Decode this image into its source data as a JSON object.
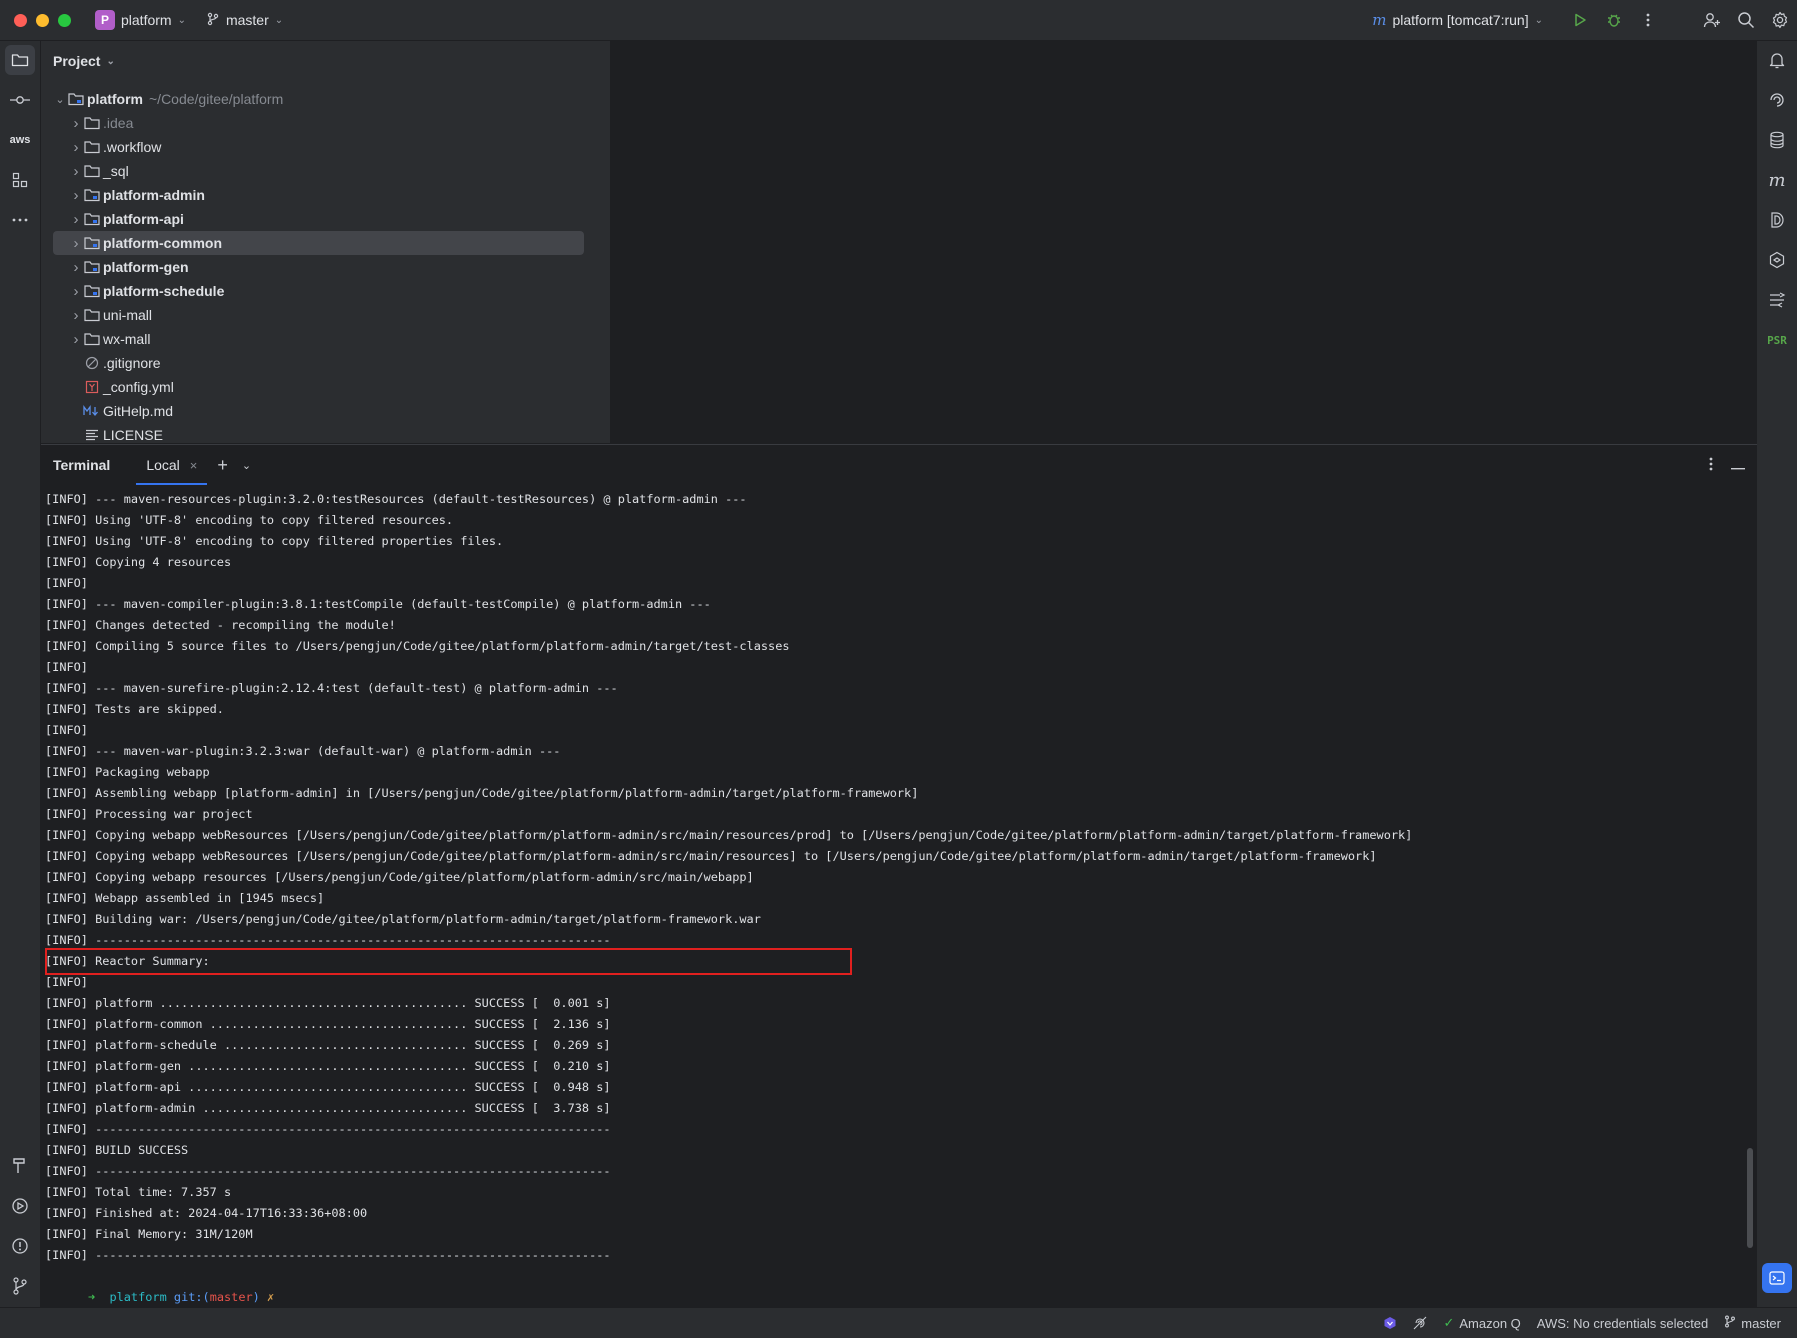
{
  "titlebar": {
    "project_initial": "P",
    "project_name": "platform",
    "branch": "master",
    "run_config_icon": "m",
    "run_config": "platform [tomcat7:run]"
  },
  "project_panel": {
    "title": "Project",
    "root": {
      "name": "platform",
      "path": "~/Code/gitee/platform"
    },
    "items": [
      {
        "name": ".idea",
        "kind": "folder",
        "dim": true,
        "bold": false,
        "expandable": true
      },
      {
        "name": ".workflow",
        "kind": "folder",
        "dim": false,
        "bold": false,
        "expandable": true
      },
      {
        "name": "_sql",
        "kind": "folder",
        "dim": false,
        "bold": false,
        "expandable": true
      },
      {
        "name": "platform-admin",
        "kind": "module",
        "dim": false,
        "bold": true,
        "expandable": true
      },
      {
        "name": "platform-api",
        "kind": "module",
        "dim": false,
        "bold": true,
        "expandable": true
      },
      {
        "name": "platform-common",
        "kind": "module",
        "dim": false,
        "bold": true,
        "expandable": true,
        "selected": true
      },
      {
        "name": "platform-gen",
        "kind": "module",
        "dim": false,
        "bold": true,
        "expandable": true
      },
      {
        "name": "platform-schedule",
        "kind": "module",
        "dim": false,
        "bold": true,
        "expandable": true
      },
      {
        "name": "uni-mall",
        "kind": "folder",
        "dim": false,
        "bold": false,
        "expandable": true
      },
      {
        "name": "wx-mall",
        "kind": "folder",
        "dim": false,
        "bold": false,
        "expandable": true
      },
      {
        "name": ".gitignore",
        "kind": "ignore",
        "dim": false,
        "bold": false,
        "expandable": false
      },
      {
        "name": "_config.yml",
        "kind": "yaml",
        "dim": false,
        "bold": false,
        "expandable": false
      },
      {
        "name": "GitHelp.md",
        "kind": "markdown",
        "dim": false,
        "bold": false,
        "expandable": false
      },
      {
        "name": "LICENSE",
        "kind": "text",
        "dim": false,
        "bold": false,
        "expandable": false
      }
    ]
  },
  "terminal": {
    "title": "Terminal",
    "tab": "Local",
    "lines": [
      "[INFO] --- maven-resources-plugin:3.2.0:testResources (default-testResources) @ platform-admin ---",
      "[INFO] Using 'UTF-8' encoding to copy filtered resources.",
      "[INFO] Using 'UTF-8' encoding to copy filtered properties files.",
      "[INFO] Copying 4 resources",
      "[INFO]",
      "[INFO] --- maven-compiler-plugin:3.8.1:testCompile (default-testCompile) @ platform-admin ---",
      "[INFO] Changes detected - recompiling the module!",
      "[INFO] Compiling 5 source files to /Users/pengjun/Code/gitee/platform/platform-admin/target/test-classes",
      "[INFO]",
      "[INFO] --- maven-surefire-plugin:2.12.4:test (default-test) @ platform-admin ---",
      "[INFO] Tests are skipped.",
      "[INFO]",
      "[INFO] --- maven-war-plugin:3.2.3:war (default-war) @ platform-admin ---",
      "[INFO] Packaging webapp",
      "[INFO] Assembling webapp [platform-admin] in [/Users/pengjun/Code/gitee/platform/platform-admin/target/platform-framework]",
      "[INFO] Processing war project",
      "[INFO] Copying webapp webResources [/Users/pengjun/Code/gitee/platform/platform-admin/src/main/resources/prod] to [/Users/pengjun/Code/gitee/platform/platform-admin/target/platform-framework]",
      "[INFO] Copying webapp webResources [/Users/pengjun/Code/gitee/platform/platform-admin/src/main/resources] to [/Users/pengjun/Code/gitee/platform/platform-admin/target/platform-framework]",
      "[INFO] Copying webapp resources [/Users/pengjun/Code/gitee/platform/platform-admin/src/main/webapp]",
      "[INFO] Webapp assembled in [1945 msecs]",
      "[INFO] Building war: /Users/pengjun/Code/gitee/platform/platform-admin/target/platform-framework.war",
      "[INFO] ------------------------------------------------------------------------",
      "[INFO] Reactor Summary:",
      "[INFO]",
      "[INFO] platform ........................................... SUCCESS [  0.001 s]",
      "[INFO] platform-common .................................... SUCCESS [  2.136 s]",
      "[INFO] platform-schedule .................................. SUCCESS [  0.269 s]",
      "[INFO] platform-gen ....................................... SUCCESS [  0.210 s]",
      "[INFO] platform-api ....................................... SUCCESS [  0.948 s]",
      "[INFO] platform-admin ..................................... SUCCESS [  3.738 s]",
      "[INFO] ------------------------------------------------------------------------",
      "[INFO] BUILD SUCCESS",
      "[INFO] ------------------------------------------------------------------------",
      "[INFO] Total time: 7.357 s",
      "[INFO] Finished at: 2024-04-17T16:33:36+08:00",
      "[INFO] Final Memory: 31M/120M",
      "[INFO] ------------------------------------------------------------------------"
    ],
    "prompt": {
      "arrow": "➜",
      "dir": "platform",
      "git_label": "git:(",
      "branch": "master",
      "git_close": ")",
      "dirty": "✗"
    }
  },
  "statusbar": {
    "amazon_q": "Amazon Q",
    "aws_status": "AWS: No credentials selected",
    "branch": "master"
  },
  "colors": {
    "accent": "#3574f0",
    "highlight_box": "#e0201f",
    "success_green": "#3fb950"
  }
}
